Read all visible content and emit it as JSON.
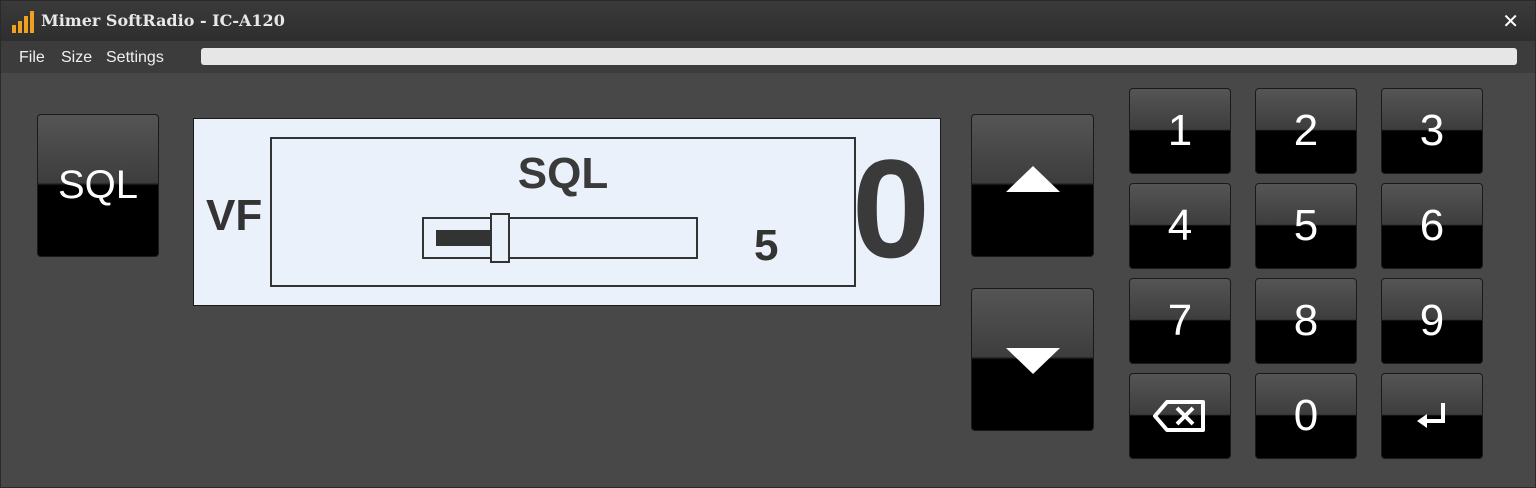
{
  "window": {
    "title": "Mimer SoftRadio - IC-A120",
    "close_label": "✕"
  },
  "menu": {
    "items": [
      "File",
      "Size",
      "Settings"
    ]
  },
  "progress": {
    "value": 0
  },
  "sql_button": {
    "label": "SQL"
  },
  "display": {
    "mode_text": "VF",
    "digit_text": "0",
    "popup": {
      "title": "SQL",
      "level": 5,
      "level_text": "5",
      "level_fraction": 0.28
    }
  },
  "keypad": {
    "keys": [
      "1",
      "2",
      "3",
      "4",
      "5",
      "6",
      "7",
      "8",
      "9",
      "⌫",
      "0",
      "↵"
    ]
  },
  "icons": {
    "app": "signal-bars-icon",
    "up": "triangle-up-icon",
    "down": "triangle-down-icon",
    "backspace": "backspace-icon",
    "enter": "enter-icon"
  },
  "colors": {
    "window_bg": "#484848",
    "display_bg": "#eaf1fa",
    "icon_orange": "#f0a020"
  }
}
